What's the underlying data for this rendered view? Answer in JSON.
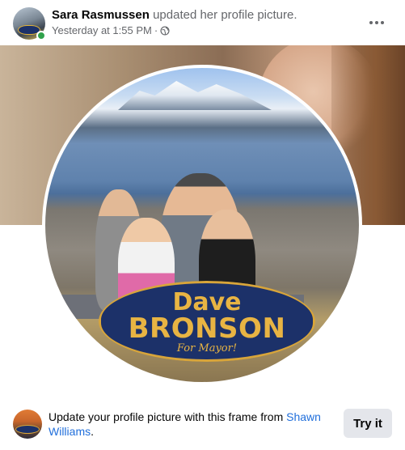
{
  "post": {
    "author": "Sara Rasmussen",
    "action": "updated her profile picture.",
    "timestamp": "Yesterday at 1:55 PM",
    "separator": "·",
    "audience_icon": "globe-icon",
    "more_icon": "more-horizontal-icon",
    "online_status_color": "#31a24c"
  },
  "photo": {
    "frame": {
      "first_name": "Dave",
      "last_name": "BRONSON",
      "tagline": "For Mayor!"
    }
  },
  "frame_prompt": {
    "text": "Update your profile picture with this frame from",
    "creator": "Shawn Williams",
    "end_punct": ".",
    "button_label": "Try it"
  },
  "colors": {
    "link": "#216fdb",
    "frame_navy": "#1c3169",
    "frame_gold": "#e8b443",
    "button_bg": "#e4e6eb"
  }
}
